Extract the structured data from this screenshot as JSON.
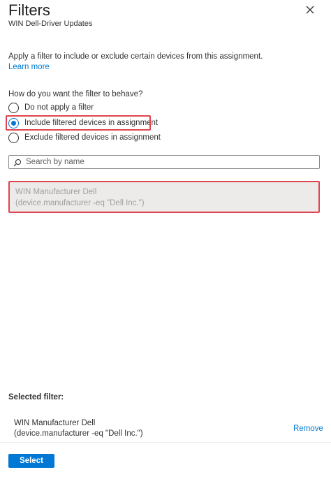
{
  "panel": {
    "title": "Filters",
    "subtitle": "WIN Dell-Driver Updates"
  },
  "description": "Apply a filter to include or exclude certain devices from this assignment.",
  "learn_more": "Learn more",
  "behavior": {
    "question": "How do you want the filter to behave?",
    "options": [
      {
        "label": "Do not apply a filter",
        "selected": false
      },
      {
        "label": "Include filtered devices in assignment",
        "selected": true
      },
      {
        "label": "Exclude filtered devices in assignment",
        "selected": false
      }
    ]
  },
  "search": {
    "placeholder": "Search by name",
    "value": ""
  },
  "filter_list": [
    {
      "name": "WIN Manufacturer Dell",
      "rule": "(device.manufacturer -eq \"Dell Inc.\")"
    }
  ],
  "selected_filter": {
    "heading": "Selected filter:",
    "name": "WIN Manufacturer Dell",
    "rule": "(device.manufacturer -eq \"Dell Inc.\")",
    "remove_label": "Remove"
  },
  "footer": {
    "select_label": "Select"
  },
  "colors": {
    "accent": "#0078d4",
    "highlight": "#e0444f",
    "disabled_item_bg": "#edebe9"
  },
  "icons": {
    "close": "close-icon",
    "search": "search-icon"
  }
}
